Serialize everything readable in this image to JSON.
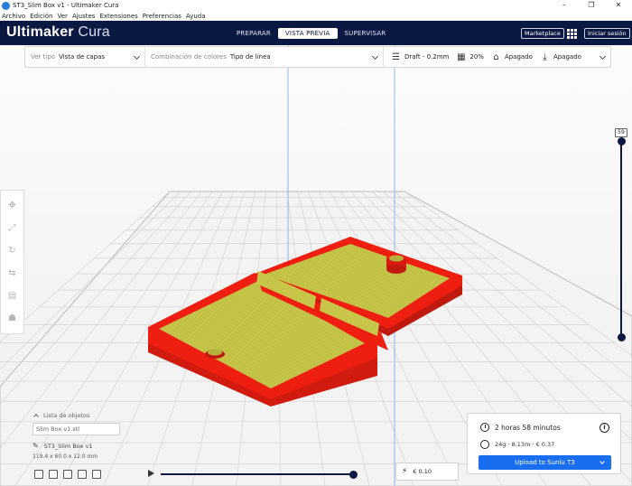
{
  "window": {
    "title": "ST3_Slim Box v1 - Ultimaker Cura",
    "controls": [
      "–",
      "❐",
      "✕"
    ]
  },
  "menu": [
    "Archivo",
    "Edición",
    "Ver",
    "Ajustes",
    "Extensiones",
    "Preferencias",
    "Ayuda"
  ],
  "header": {
    "brand_bold": "Ultimaker",
    "brand_light": "Cura",
    "stages": [
      "PREPARAR",
      "VISTA PREVIA",
      "SUPERVISAR"
    ],
    "active_stage": "VISTA PREVIA",
    "marketplace_label": "Marketplace",
    "signin_label": "Iniciar sesión"
  },
  "toolbar": {
    "view_type_label": "Ver tipo",
    "view_type_value": "Vista de capas",
    "color_scheme_label": "Combinación de colores",
    "color_scheme_value": "Tipo de línea",
    "profile": "Draft - 0.2mm",
    "infill": "20%",
    "support": "Apagado",
    "adhesion": "Apagado"
  },
  "layer_view": {
    "current_layer": "59"
  },
  "object_list": {
    "header": "Lista de objetos",
    "name_field": "Slim Box v1.stl",
    "object_name": "ST3_Slim Box v1",
    "dimensions": "119.4 x 60.0 x 12.0 mm"
  },
  "cost_box": {
    "value": "€ 0.10"
  },
  "print_info": {
    "time": "2 horas 58 minutos",
    "material": "24g · 8.13m · € 0.37",
    "button": "Upload to Sunlu T3"
  },
  "colors": {
    "header_bg": "#0b1842",
    "accent_blue": "#196ef0",
    "wall_red": "#ee1f10",
    "infill_yellow": "#c7c64a"
  }
}
